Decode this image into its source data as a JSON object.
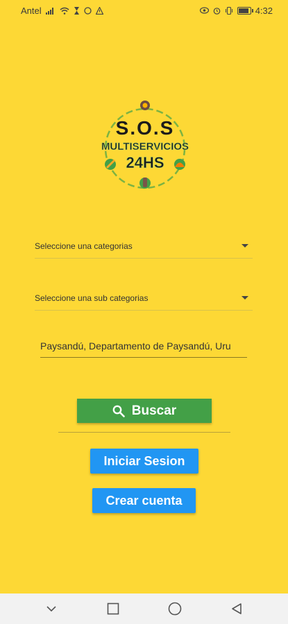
{
  "status_bar": {
    "carrier": "Antel",
    "time": "4:32"
  },
  "logo": {
    "line1": "S.O.S",
    "line2": "MULTISERVICIOS",
    "line3": "24HS"
  },
  "form": {
    "category_placeholder": "Seleccione una categorias",
    "subcategory_placeholder": "Seleccione una sub categorias",
    "location_value": "Paysandú, Departamento de Paysandú, Uru"
  },
  "buttons": {
    "search_label": "Buscar",
    "login_label": "Iniciar Sesion",
    "register_label": "Crear cuenta"
  },
  "colors": {
    "background": "#FDD835",
    "search_button": "#43A047",
    "primary_button": "#2196F3"
  },
  "icons": {
    "search": "search-icon",
    "nav_back": "back-icon",
    "nav_home": "home-icon",
    "nav_recents": "recents-icon",
    "nav_collapse": "collapse-icon"
  }
}
